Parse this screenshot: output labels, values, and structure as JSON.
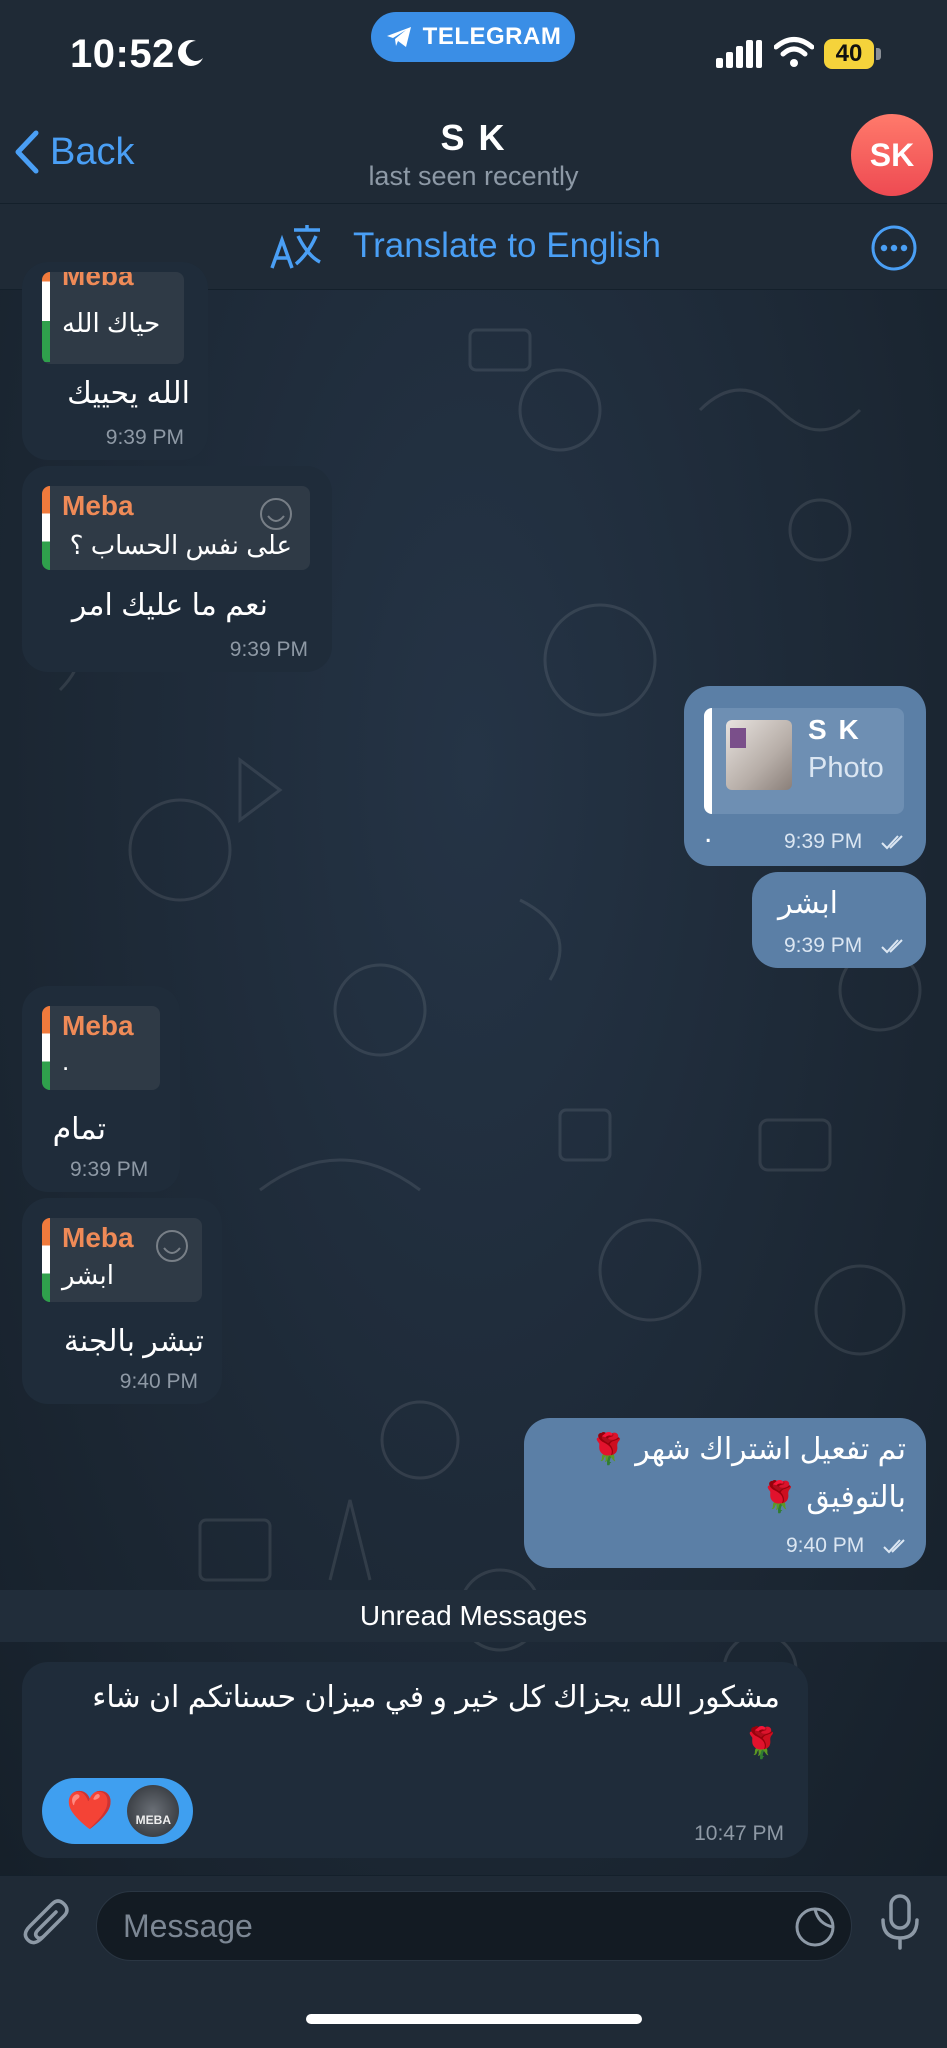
{
  "status_bar": {
    "time": "10:52",
    "app_badge": "TELEGRAM",
    "battery": "40"
  },
  "header": {
    "back_label": "Back",
    "title": "S K",
    "subtitle": "last seen recently",
    "avatar_initials": "SK"
  },
  "translate": {
    "label": "Translate to English"
  },
  "messages": [
    {
      "dir": "in",
      "reply_name": "Meba",
      "reply_text": "حياك الله",
      "text": "الله يحييك",
      "time": "9:39 PM"
    },
    {
      "dir": "in",
      "reply_name": "Meba",
      "reply_text": "على نفس الحساب ؟",
      "text": "نعم ما عليك امر",
      "time": "9:39 PM"
    },
    {
      "dir": "out",
      "reply_name": "S K",
      "reply_text": "Photo",
      "text": ".",
      "time": "9:39 PM"
    },
    {
      "dir": "out",
      "text": "ابشر",
      "time": "9:39 PM"
    },
    {
      "dir": "in",
      "reply_name": "Meba",
      "reply_text": ".",
      "text": "تمام",
      "time": "9:39 PM"
    },
    {
      "dir": "in",
      "reply_name": "Meba",
      "reply_text": "ابشر",
      "text": "تبشر بالجنة",
      "time": "9:40 PM"
    },
    {
      "dir": "out",
      "text_line1": "تم تفعيل اشتراك شهر 🌹",
      "text_line2": "بالتوفيق 🌹",
      "time": "9:40 PM"
    },
    {
      "dir": "in",
      "text_line1": "مشكور الله يجزاك كل خير و في ميزان حسناتكم ان شاء",
      "text_line2": "🌹",
      "time": "10:47 PM",
      "reactions": [
        "❤️",
        "MEBA"
      ]
    }
  ],
  "unread_label": "Unread Messages",
  "composer": {
    "placeholder": "Message"
  },
  "colors": {
    "accent": "#4a9ff5",
    "outgoing_bubble": "#5b7fa6",
    "incoming_bubble": "#1f2c3a",
    "reply_name": "#ef8a57",
    "avatar": "#ee4a52"
  }
}
